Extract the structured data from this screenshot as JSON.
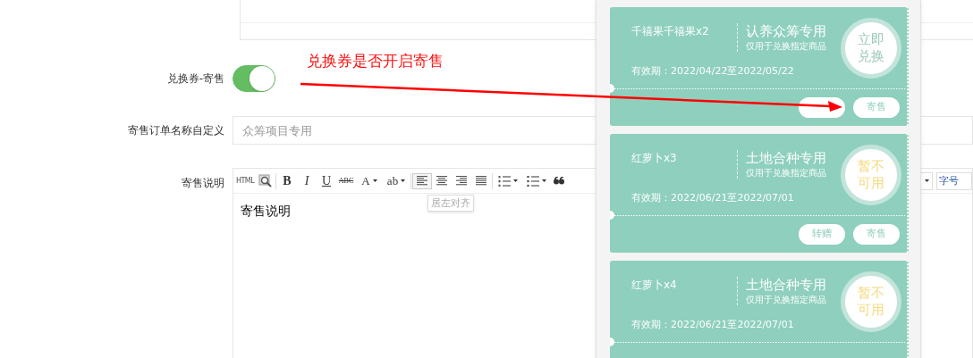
{
  "form": {
    "fields": [
      {
        "kind": "toggle",
        "label": "兑换券-寄售",
        "on": true
      },
      {
        "kind": "input",
        "label": "寄售订单名称自定义",
        "placeholder": "众筹项目专用"
      },
      {
        "kind": "editor",
        "label": "寄售说明",
        "value": "寄售说明"
      }
    ]
  },
  "toolbar": {
    "items": [
      {
        "kind": "text",
        "label": "HTML",
        "selected": false
      },
      {
        "kind": "preview",
        "selected": false
      },
      {
        "kind": "sep"
      },
      {
        "kind": "bold",
        "label": "B",
        "selected": false
      },
      {
        "kind": "italic",
        "label": "I",
        "selected": false
      },
      {
        "kind": "underline",
        "label": "U",
        "selected": false
      },
      {
        "kind": "strike",
        "label": "ABC",
        "selected": false
      },
      {
        "kind": "dropdown",
        "label": "A",
        "selected": false
      },
      {
        "kind": "dropdown",
        "label": "ab",
        "selected": false
      },
      {
        "kind": "sep"
      },
      {
        "kind": "align-left",
        "selected": true
      },
      {
        "kind": "align-center",
        "selected": false
      },
      {
        "kind": "align-right",
        "selected": false
      },
      {
        "kind": "align-justify",
        "selected": false
      },
      {
        "kind": "sep"
      },
      {
        "kind": "ordered-list",
        "selected": false
      },
      {
        "kind": "bullet-list",
        "selected": false
      },
      {
        "kind": "quote",
        "selected": false
      }
    ],
    "font_size": "字号",
    "tooltip": "居左对齐"
  },
  "annotation": {
    "text": "兑换券是否开启寄售"
  },
  "coupons": [
    {
      "title": "千禧果千禧果x2",
      "name": "认养众筹专用",
      "note": "仅用于兑换指定商品",
      "validity": "有效期：2022/04/22至2022/05/22",
      "stamp": "立即兑换",
      "available": true,
      "buttons": [
        {
          "kind": "blank"
        },
        {
          "kind": "text",
          "label": "寄售"
        }
      ]
    },
    {
      "title": "红萝卜x3",
      "name": "土地合种专用",
      "note": "仅用于兑换指定商品",
      "validity": "有效期：2022/06/21至2022/07/01",
      "stamp": "暂不可用",
      "available": false,
      "buttons": [
        {
          "kind": "text",
          "label": "转赠"
        },
        {
          "kind": "text",
          "label": "寄售"
        }
      ]
    },
    {
      "title": "红萝卜x4",
      "name": "土地合种专用",
      "note": "仅用于兑换指定商品",
      "validity": "有效期：2022/06/21至2022/07/01",
      "stamp": "暂不可用",
      "available": false
    }
  ]
}
